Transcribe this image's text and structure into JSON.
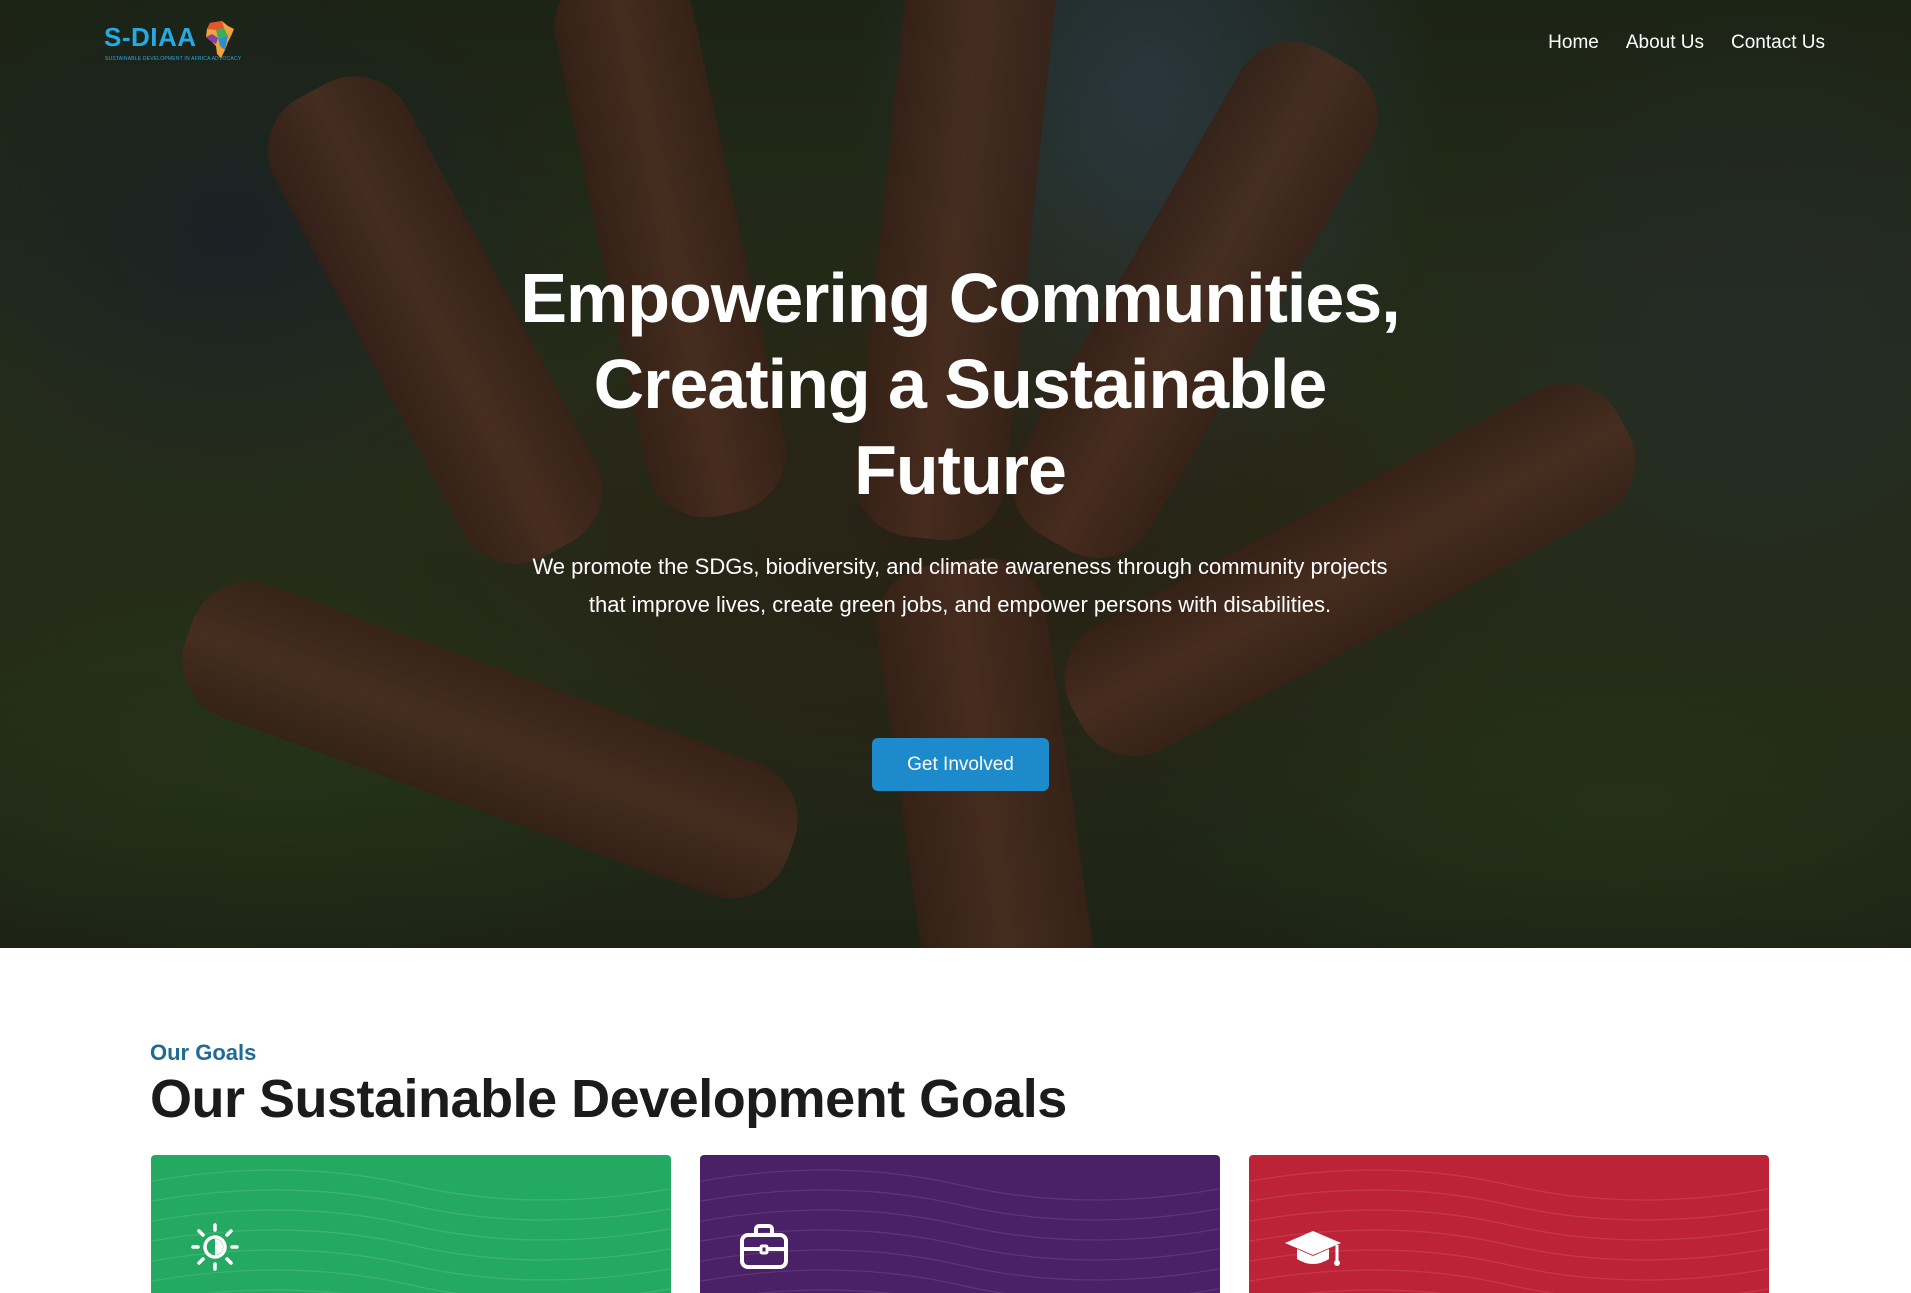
{
  "brand": {
    "name": "S-DIAA",
    "tagline": "SUSTAINABLE DEVELOPMENT IN AFRICA ADVOCACY",
    "color": "#27a9e1"
  },
  "nav": {
    "items": [
      {
        "label": "Home"
      },
      {
        "label": "About Us"
      },
      {
        "label": "Contact Us"
      }
    ]
  },
  "hero": {
    "title": "Empowering Communities, Creating a Sustainable Future",
    "subtitle": "We promote the SDGs, biodiversity, and climate awareness through community projects that improve lives, create green jobs, and empower persons with disabilities.",
    "cta_label": "Get Involved",
    "cta_color": "#1d8acb"
  },
  "goals": {
    "eyebrow": "Our Goals",
    "title": "Our Sustainable Development Goals",
    "cards": [
      {
        "icon": "sun-icon",
        "color": "#24a963"
      },
      {
        "icon": "briefcase-icon",
        "color": "#4a2066"
      },
      {
        "icon": "graduation-cap-icon",
        "color": "#bd2337"
      }
    ]
  }
}
